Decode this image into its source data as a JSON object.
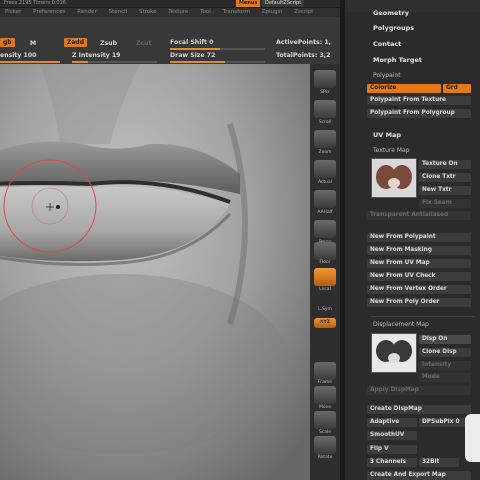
{
  "titlebar": {
    "text": "Frees 2195  Timers 0.016",
    "menus_label": "Menus",
    "script_label": "DefaultZScript"
  },
  "menubar": [
    "Picker",
    "Preferences",
    "Render",
    "Stencil",
    "Stroke",
    "Texture",
    "Tool",
    "Transform",
    "Zplugin",
    "Zscript"
  ],
  "shelf": {
    "rgb": "gb",
    "m": "M",
    "zadd": "Zadd",
    "zsub": "Zsub",
    "zcut": "Zcut",
    "focal_shift_label": "Focal Shift 0",
    "active_points": "ActivePoints: 1,",
    "intensity": "ensity 100",
    "z_intensity": "Z Intensity 19",
    "draw_size": "Draw Size 72",
    "total_points": "TotalPoints: 3,2"
  },
  "toolbar": {
    "spix": "SPix",
    "scroll": "Scroll",
    "zoom": "Zoom",
    "actual": "Actual",
    "aahalf": "AAHalf",
    "persp": "Persp",
    "floor": "Floor",
    "local": "Local",
    "lsym": "L.Sym",
    "xyz": "XYZ",
    "frame": "Frame",
    "move": "Move",
    "scale": "Scale",
    "rotate": "Rotate"
  },
  "palette": {
    "top_items": [
      "Geometry",
      "Polygroups",
      "Contact",
      "Morph Target"
    ],
    "polypaint_title": "Polypaint",
    "colorize": "Colorize",
    "grd": "Grd",
    "polypaint_from_texture": "Polypaint From Texture",
    "polypaint_from_polygroup": "Polypaint From Polygroup",
    "uv_map": "UV Map",
    "texture_map_title": "Texture Map",
    "texture_on": "Texture On",
    "clone_txtr": "Clone Txtr",
    "new_txtr": "New Txtr",
    "fix_seam": "Fix Seam",
    "transparent_antialiased": "Transparent  Antialiased",
    "new_buttons": [
      "New From Polypaint",
      "New From Masking",
      "New From UV Map",
      "New From UV Check",
      "New From Vertex Order",
      "New From Poly Order"
    ],
    "displacement_title": "Displacement Map",
    "disp_on": "Disp On",
    "clone_disp": "Clone Disp",
    "intensity": "Intensity",
    "mode": "Mode",
    "apply_dispmap": "Apply DispMap",
    "create_dispmap": "Create DispMap",
    "adaptive": "Adaptive",
    "dpsubpix": "DPSubPix 0",
    "smooth_uv": "SmoothUV",
    "flip_v": "Flip V",
    "channels": "3 Channels",
    "bit_depth": "32Bit",
    "create_export": "Create And Export Map"
  },
  "colors": {
    "accent": "#e07b18",
    "panel": "#2b2b2b",
    "viewport": "#9a9a9a"
  }
}
